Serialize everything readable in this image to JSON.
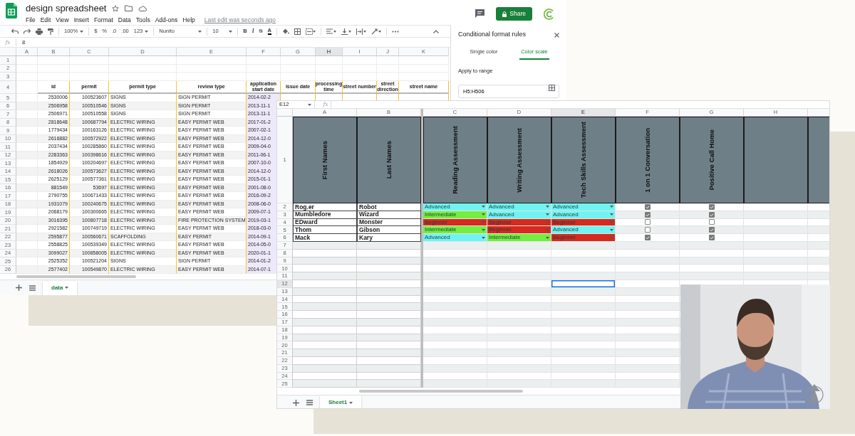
{
  "back_window": {
    "title": "design spreadsheet",
    "menu": [
      "File",
      "Edit",
      "View",
      "Insert",
      "Format",
      "Data",
      "Tools",
      "Add-ons",
      "Help"
    ],
    "last_edit": "Last edit was seconds ago",
    "share_label": "Share",
    "toolbar": {
      "zoom": "100%",
      "currency": "$",
      "percent": "%",
      "decimal_decrease": ".0",
      "decimal_increase": ".00",
      "number_format": "123",
      "font": "Nunito",
      "font_size": "10",
      "bold": "B",
      "italic": "I",
      "strikethrough": "S",
      "text_color": "A"
    },
    "formula": {
      "fx": "fx",
      "value": "8"
    },
    "columns": [
      {
        "label": "A",
        "selected": false
      },
      {
        "label": "B",
        "selected": false
      },
      {
        "label": "C",
        "selected": false
      },
      {
        "label": "D",
        "selected": false
      },
      {
        "label": "E",
        "selected": false
      },
      {
        "label": "F",
        "selected": false
      },
      {
        "label": "G",
        "selected": false
      },
      {
        "label": "H",
        "selected": true
      },
      {
        "label": "I",
        "selected": false
      },
      {
        "label": "J",
        "selected": false
      },
      {
        "label": "K",
        "selected": false
      }
    ],
    "blank_rows": [
      "1",
      "2",
      "3"
    ],
    "header_row": {
      "label": "4",
      "cells": [
        "",
        "id",
        "permit",
        "permit type",
        "review type",
        "application start date",
        "issue date",
        "processing time",
        "street number",
        "street direction",
        "street name"
      ]
    },
    "rows": [
      {
        "label": "5",
        "cells": [
          "",
          "2530006",
          "100523607",
          "SIGNS",
          "SIGN PERMIT",
          "2014-02-2"
        ]
      },
      {
        "label": "6",
        "cells": [
          "",
          "2506958",
          "100510546",
          "SIGNS",
          "SIGN PERMIT",
          "2013-11-1"
        ]
      },
      {
        "label": "7",
        "cells": [
          "",
          "2506971",
          "100510558",
          "SIGNS",
          "SIGN PERMIT",
          "2013-11-1"
        ]
      },
      {
        "label": "8",
        "cells": [
          "",
          "2818648",
          "100687794",
          "ELECTRIC WIRING",
          "EASY PERMIT WEB",
          "2017-01-2"
        ]
      },
      {
        "label": "9",
        "cells": [
          "",
          "1779434",
          "100163126",
          "ELECTRIC WIRING",
          "EASY PERMIT WEB",
          "2007-02-1"
        ]
      },
      {
        "label": "10",
        "cells": [
          "",
          "2616882",
          "100572922",
          "ELECTRIC WIRING",
          "EASY PERMIT WEB",
          "2014-12-0"
        ]
      },
      {
        "label": "11",
        "cells": [
          "",
          "2037434",
          "100285860",
          "ELECTRIC WIRING",
          "EASY PERMIT WEB",
          "2009-04-0"
        ]
      },
      {
        "label": "12",
        "cells": [
          "",
          "2283363",
          "100398616",
          "ELECTRIC WIRING",
          "EASY PERMIT WEB",
          "2011-06-1"
        ]
      },
      {
        "label": "13",
        "cells": [
          "",
          "1854929",
          "100204697",
          "ELECTRIC WIRING",
          "EASY PERMIT WEB",
          "2007-10-0"
        ]
      },
      {
        "label": "14",
        "cells": [
          "",
          "2618026",
          "100573627",
          "ELECTRIC WIRING",
          "EASY PERMIT WEB",
          "2014-12-0"
        ]
      },
      {
        "label": "15",
        "cells": [
          "",
          "2625129",
          "100577361",
          "ELECTRIC WIRING",
          "EASY PERMIT WEB",
          "2015-01-1"
        ]
      },
      {
        "label": "16",
        "cells": [
          "",
          "881549",
          "53697",
          "ELECTRIC WIRING",
          "EASY PERMIT WEB",
          "2001-08-0"
        ]
      },
      {
        "label": "17",
        "cells": [
          "",
          "2790755",
          "100671433",
          "ELECTRIC WIRING",
          "EASY PERMIT WEB",
          "2016-09-2"
        ]
      },
      {
        "label": "18",
        "cells": [
          "",
          "1931079",
          "100240675",
          "ELECTRIC WIRING",
          "EASY PERMIT WEB",
          "2008-06-0"
        ]
      },
      {
        "label": "19",
        "cells": [
          "",
          "2068179",
          "100300665",
          "ELECTRIC WIRING",
          "EASY PERMIT WEB",
          "2009-07-1"
        ]
      },
      {
        "label": "20",
        "cells": [
          "",
          "3016395",
          "100807718",
          "ELECTRIC WIRING",
          "FIRE PROTECTION SYSTEM",
          "2019-03-1"
        ]
      },
      {
        "label": "21",
        "cells": [
          "",
          "2921582",
          "100749719",
          "ELECTRIC WIRING",
          "EASY PERMIT WEB",
          "2018-03-0"
        ]
      },
      {
        "label": "22",
        "cells": [
          "",
          "2595877",
          "100560671",
          "SCAFFOLDING",
          "EASY PERMIT",
          "2014-09-1"
        ]
      },
      {
        "label": "23",
        "cells": [
          "",
          "2558825",
          "100539349",
          "ELECTRIC WIRING",
          "EASY PERMIT WEB",
          "2014-05-0"
        ]
      },
      {
        "label": "24",
        "cells": [
          "",
          "3099027",
          "100858005",
          "ELECTRIC WIRING",
          "EASY PERMIT WEB",
          "2020-01-1"
        ]
      },
      {
        "label": "25",
        "cells": [
          "",
          "2525352",
          "100521204",
          "SIGNS",
          "SIGN PERMIT",
          "2014-01-2"
        ]
      },
      {
        "label": "26",
        "cells": [
          "",
          "2577402",
          "100549870",
          "ELECTRIC WIRING",
          "EASY PERMIT WEB",
          "2014-07-1"
        ]
      }
    ],
    "tabs": [
      {
        "label": "data",
        "selected": true
      }
    ],
    "panel": {
      "title": "Conditional format rules",
      "tabs": [
        {
          "label": "Single color",
          "selected": false
        },
        {
          "label": "Color scale",
          "selected": true
        }
      ],
      "range_label": "Apply to range",
      "range_value": "H5:H506"
    }
  },
  "front_window": {
    "name_box": "E12",
    "fx": "fx",
    "columns": [
      {
        "label": "A",
        "selected": false
      },
      {
        "label": "B",
        "selected": false
      },
      {
        "label": "C",
        "selected": false
      },
      {
        "label": "D",
        "selected": false
      },
      {
        "label": "E",
        "selected": true
      },
      {
        "label": "F",
        "selected": false
      },
      {
        "label": "G",
        "selected": false
      },
      {
        "label": "H",
        "selected": false
      }
    ],
    "header_row": {
      "label": "1",
      "cells": [
        "First Names",
        "Last Names",
        "Reading Assessment",
        "Writing Assessment",
        "Tech Skills Assessment",
        "1 on 1 Conversation",
        "Positive Call Home"
      ]
    },
    "students": [
      {
        "label": "2",
        "first": "Rog.er",
        "last": "Robot",
        "assessments": [
          {
            "value": "Advanced",
            "color": "#70f4f2"
          },
          {
            "value": "Advanced",
            "color": "#70f4f2"
          },
          {
            "value": "Advanced",
            "color": "#70f4f2"
          }
        ],
        "checks": [
          {
            "checked": true
          },
          {
            "checked": true
          }
        ]
      },
      {
        "label": "3",
        "first": "Mumbledore",
        "last": "Wizard",
        "assessments": [
          {
            "value": "Intermediate",
            "color": "#74ee40"
          },
          {
            "value": "Advanced",
            "color": "#70f4f2"
          },
          {
            "value": "Advanced",
            "color": "#70f4f2"
          }
        ],
        "checks": [
          {
            "checked": true
          },
          {
            "checked": true
          }
        ]
      },
      {
        "label": "4",
        "first": "EDward",
        "last": "Monster",
        "assessments": [
          {
            "value": "Beginner",
            "color": "#d52a1e"
          },
          {
            "value": "Beginner",
            "color": "#d52a1e"
          },
          {
            "value": "Beginner",
            "color": "#d52a1e"
          }
        ],
        "checks": [
          {
            "checked": false
          },
          {
            "checked": false
          }
        ]
      },
      {
        "label": "5",
        "first": "Thom",
        "last": "Gibson",
        "assessments": [
          {
            "value": "Intermediate",
            "color": "#74ee40"
          },
          {
            "value": "Beginner",
            "color": "#d52a1e"
          },
          {
            "value": "Advanced",
            "color": "#70f4f2"
          }
        ],
        "checks": [
          {
            "checked": false
          },
          {
            "checked": true
          }
        ]
      },
      {
        "label": "6",
        "first": "Mack",
        "last": "Kary",
        "assessments": [
          {
            "value": "Advanced",
            "color": "#70f4f2"
          },
          {
            "value": "Intermediate",
            "color": "#74ee40"
          },
          {
            "value": "Beginner",
            "color": "#d52a1e"
          }
        ],
        "checks": [
          {
            "checked": true
          },
          {
            "checked": true
          }
        ]
      }
    ],
    "empty_rows": [
      {
        "label": "7",
        "selected": false
      },
      {
        "label": "8",
        "selected": false
      },
      {
        "label": "9",
        "selected": false
      },
      {
        "label": "10",
        "selected": false
      },
      {
        "label": "11",
        "selected": false
      },
      {
        "label": "12",
        "selected": true
      },
      {
        "label": "13",
        "selected": false
      },
      {
        "label": "14",
        "selected": false
      },
      {
        "label": "15",
        "selected": false
      },
      {
        "label": "16",
        "selected": false
      },
      {
        "label": "17",
        "selected": false
      },
      {
        "label": "18",
        "selected": false
      },
      {
        "label": "19",
        "selected": false
      },
      {
        "label": "20",
        "selected": false
      },
      {
        "label": "21",
        "selected": false
      },
      {
        "label": "22",
        "selected": false
      },
      {
        "label": "23",
        "selected": false
      },
      {
        "label": "24",
        "selected": false
      },
      {
        "label": "25",
        "selected": false
      }
    ],
    "tabs": [
      {
        "label": "Sheet1",
        "selected": true
      }
    ]
  }
}
